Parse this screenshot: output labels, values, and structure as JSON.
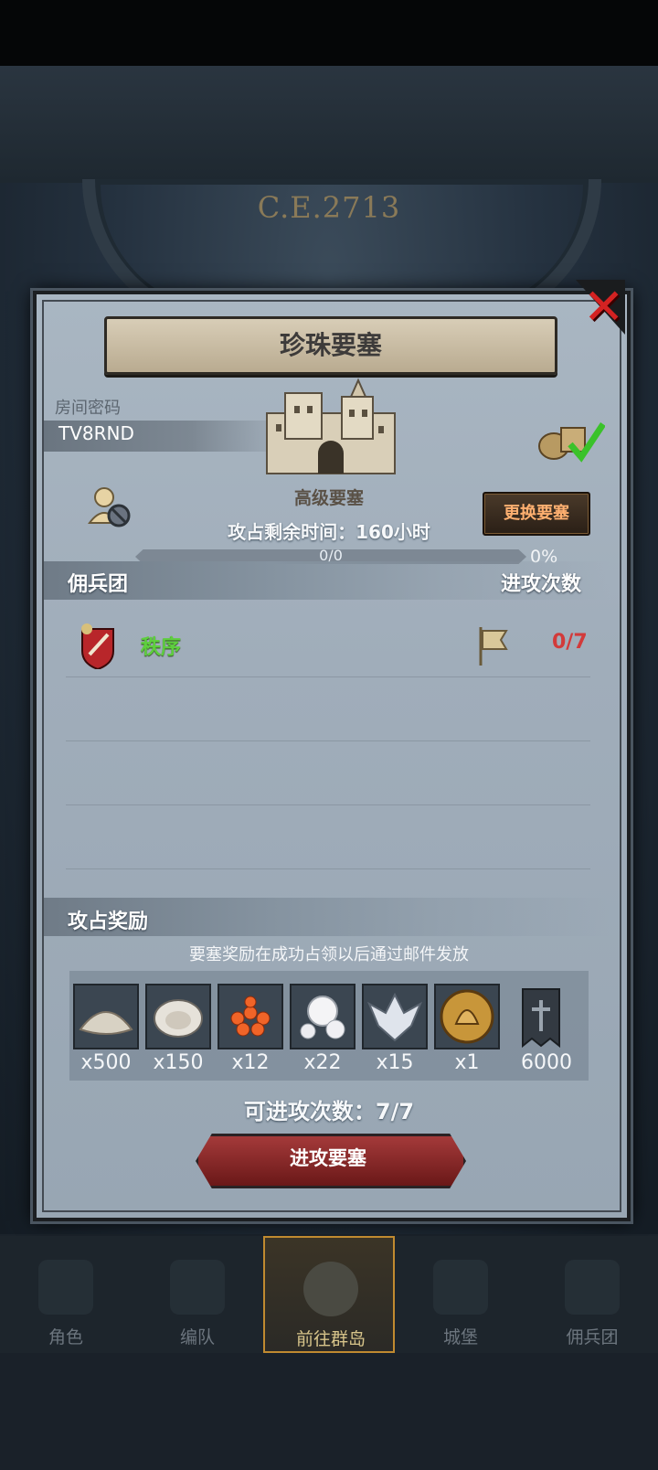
{
  "era": "C.E.2713",
  "dialog": {
    "title": "珍珠要塞",
    "room_label": "房间密码",
    "room_code": "TV8RND",
    "fortress_level": "高级要塞",
    "change_button": "更换要塞",
    "timer_text": "攻占剩余时间：160小时",
    "progress_text": "0/0",
    "progress_percent": "0%",
    "progress_value": 0,
    "guild_header": "佣兵团",
    "attacks_header": "进攻次数",
    "guild_row": {
      "name": "秩序",
      "count": "0/7"
    },
    "reward_header": "攻占奖励",
    "reward_note": "要塞奖励在成功占领以后通过邮件发放",
    "rewards": [
      {
        "icon": "salt-pile-icon",
        "qty": "x500"
      },
      {
        "icon": "oyster-icon",
        "qty": "x150"
      },
      {
        "icon": "fish-roe-icon",
        "qty": "x12"
      },
      {
        "icon": "pearls-icon",
        "qty": "x22"
      },
      {
        "icon": "winged-emblem-icon",
        "qty": "x15"
      },
      {
        "icon": "knight-helmet-medal-icon",
        "qty": "x1"
      },
      {
        "icon": "guild-banner-icon",
        "qty": "6000"
      }
    ],
    "attacks_left": "可进攻次数：7/7",
    "attack_button": "进攻要塞"
  },
  "nav": [
    {
      "label": "角色"
    },
    {
      "label": "编队"
    },
    {
      "label": "前往群岛",
      "active": true
    },
    {
      "label": "城堡"
    },
    {
      "label": "佣兵团"
    }
  ],
  "colors": {
    "guild_name": "#5ecf3e",
    "attack_count": "#d23a3a",
    "close_x": "#d42222",
    "change_button_text": "#ffb070",
    "attack_button": "#a43a3a"
  }
}
